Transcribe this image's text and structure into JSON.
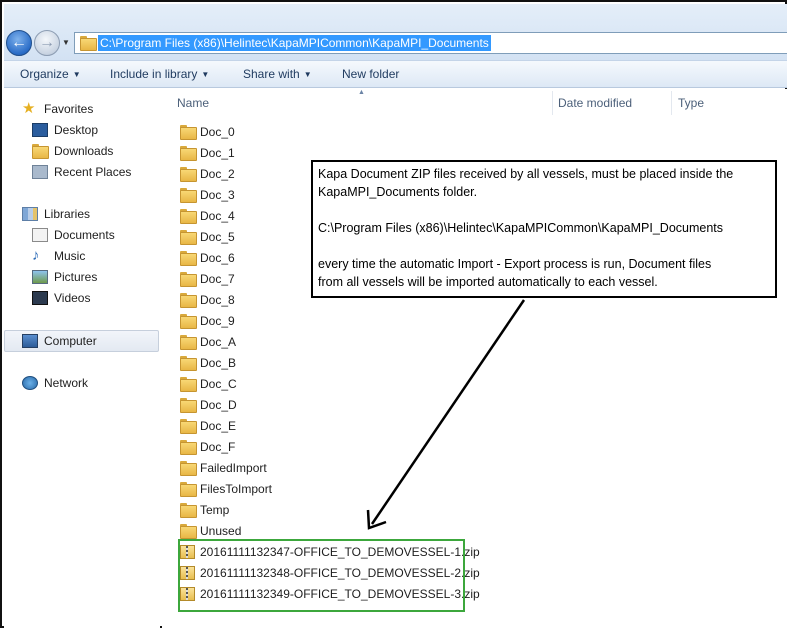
{
  "address_bar": {
    "path": "C:\\Program Files (x86)\\Helintec\\KapaMPICommon\\KapaMPI_Documents"
  },
  "toolbar": {
    "organize": "Organize",
    "include_in_library": "Include in library",
    "share_with": "Share with",
    "new_folder": "New folder"
  },
  "nav": {
    "favorites": "Favorites",
    "desktop": "Desktop",
    "downloads": "Downloads",
    "recent_places": "Recent Places",
    "libraries": "Libraries",
    "documents": "Documents",
    "music": "Music",
    "pictures": "Pictures",
    "videos": "Videos",
    "computer": "Computer",
    "network": "Network"
  },
  "columns": {
    "name": "Name",
    "date_modified": "Date modified",
    "type": "Type"
  },
  "folders": [
    "Doc_0",
    "Doc_1",
    "Doc_2",
    "Doc_3",
    "Doc_4",
    "Doc_5",
    "Doc_6",
    "Doc_7",
    "Doc_8",
    "Doc_9",
    "Doc_A",
    "Doc_B",
    "Doc_C",
    "Doc_D",
    "Doc_E",
    "Doc_F",
    "FailedImport",
    "FilesToImport",
    "Temp",
    "Unused"
  ],
  "zip_files": [
    "20161111132347-OFFICE_TO_DEMOVESSEL-1.zip",
    "20161111132348-OFFICE_TO_DEMOVESSEL-2.zip",
    "20161111132349-OFFICE_TO_DEMOVESSEL-3.zip"
  ],
  "annotation": {
    "line1": "Kapa Document ZIP files received by all vessels, must be placed inside the",
    "line2": "KapaMPI_Documents folder.",
    "line3": "C:\\Program Files (x86)\\Helintec\\KapaMPICommon\\KapaMPI_Documents",
    "line4": "every time the automatic Import - Export process is run, Document files",
    "line5": "from all vessels will be imported automatically to each vessel."
  },
  "colors": {
    "selection": "#3399ff",
    "highlight_border": "#3ca73c",
    "folder": "#f8d775"
  }
}
